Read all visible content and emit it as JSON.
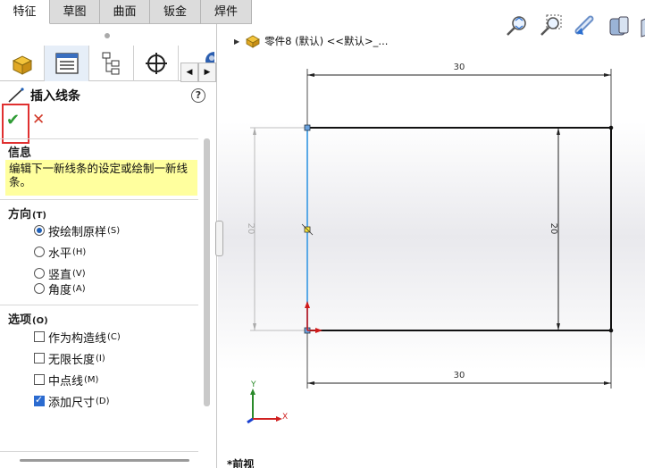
{
  "tabs": [
    {
      "label": "特征",
      "active": true
    },
    {
      "label": "草图",
      "active": false
    },
    {
      "label": "曲面",
      "active": false
    },
    {
      "label": "钣金",
      "active": false
    },
    {
      "label": "焊件",
      "active": false
    }
  ],
  "feature_panel": {
    "title": "插入线条",
    "help_icon": "?",
    "ok_icon": "✔",
    "cancel_icon": "✕"
  },
  "info_section": {
    "title": "信息",
    "message": "编辑下一新线条的设定或绘制一新线条。"
  },
  "direction_section": {
    "title": "方向",
    "title_key": "(T)",
    "options": [
      {
        "label": "按绘制原样",
        "key": "(S)",
        "selected": true
      },
      {
        "label": "水平",
        "key": "(H)",
        "selected": false
      },
      {
        "label": "竖直",
        "key": "(V)",
        "selected": false
      },
      {
        "label": "角度",
        "key": "(A)",
        "selected": false
      }
    ]
  },
  "options_section": {
    "title": "选项",
    "title_key": "(O)",
    "options": [
      {
        "label": "作为构造线",
        "key": "(C)",
        "checked": false
      },
      {
        "label": "无限长度",
        "key": "(I)",
        "checked": false
      },
      {
        "label": "中点线",
        "key": "(M)",
        "checked": false
      },
      {
        "label": "添加尺寸",
        "key": "(D)",
        "checked": true
      }
    ]
  },
  "graphics": {
    "tree_node_label": "零件8 (默认) <<默认>_...",
    "view_label": "*前视",
    "dimensions": {
      "top": "30",
      "bottom": "30",
      "right": "20",
      "left": "20"
    },
    "axis_labels": {
      "y": "Y",
      "x": "X"
    }
  },
  "colors": {
    "accent_blue": "#1e5fb8",
    "ok_green": "#2e9b34",
    "cancel_red": "#d23a2a",
    "info_yellow": "#ffff9e",
    "highlight_border": "#e03030"
  }
}
